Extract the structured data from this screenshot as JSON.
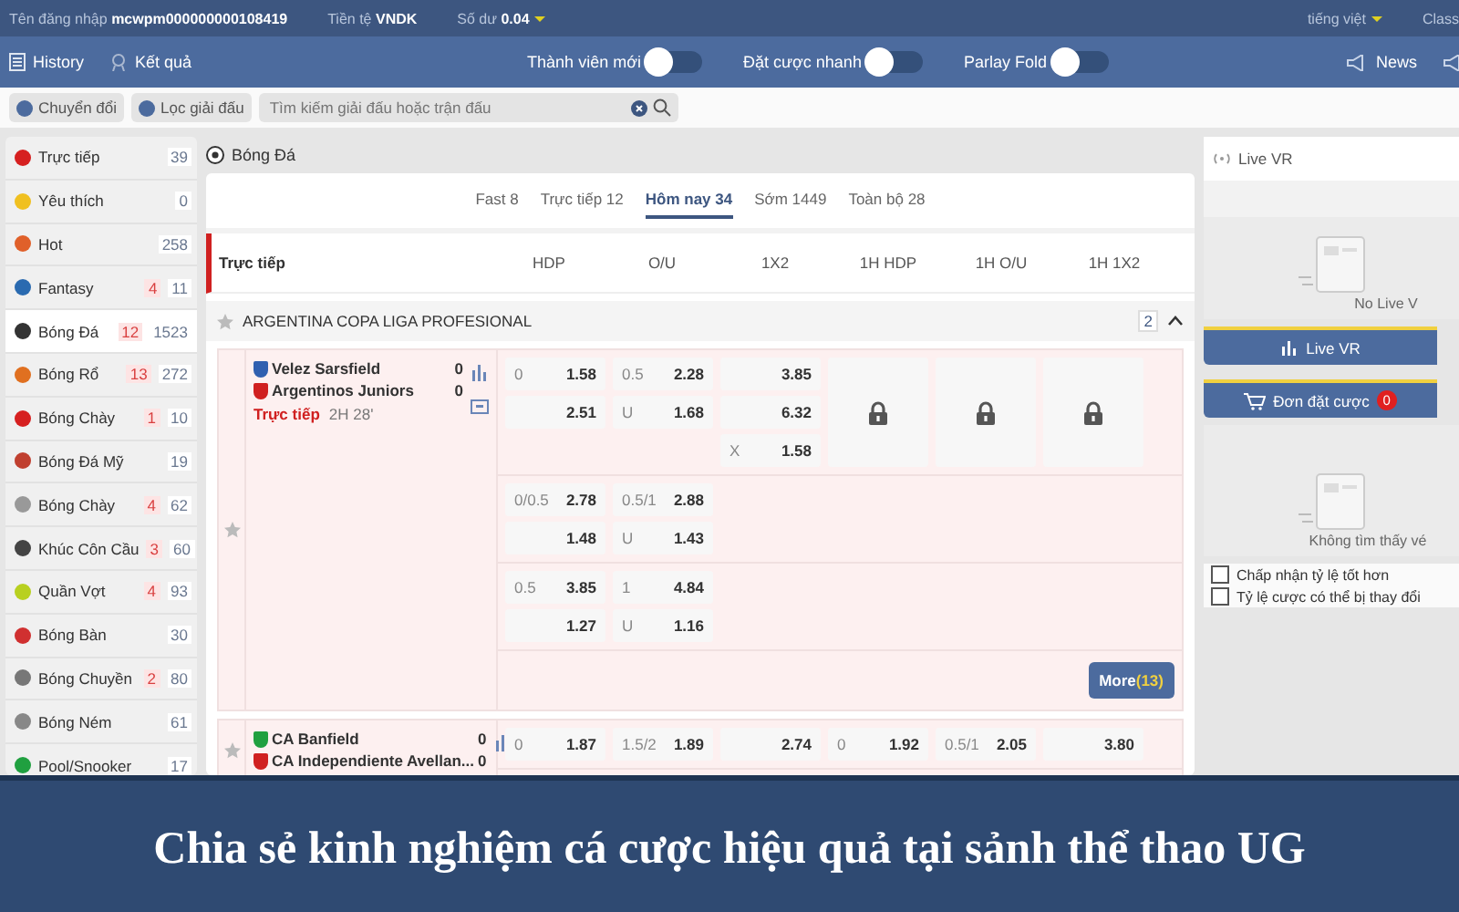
{
  "top_bar": {
    "fields": [
      {
        "label": "Tên đăng nhập",
        "value": "mcwpm000000000108419"
      },
      {
        "label": "Tiền tệ",
        "value": "VNDK"
      },
      {
        "label": "Số dư",
        "value": "0.04"
      }
    ],
    "language": "tiếng việt",
    "cut_item": "Class"
  },
  "nav_bar": {
    "links": [
      {
        "kind": "history",
        "label": "History"
      },
      {
        "kind": "results",
        "label": "Kết quả"
      }
    ],
    "toggles": [
      {
        "label": "Thành viên mới",
        "on": false
      },
      {
        "label": "Đặt cược nhanh",
        "on": false
      },
      {
        "label": "Parlay Fold",
        "on": false
      }
    ],
    "news": "News"
  },
  "filter_bar": {
    "buttons": [
      "Chuyển đổi",
      "Lọc giải đấu"
    ],
    "search": {
      "placeholder": "Tìm kiếm giải đấu hoặc trận đấu"
    }
  },
  "sidebar": {
    "items": [
      {
        "name": "Trực tiếp",
        "count": "39",
        "color": "#d62020",
        "selected": false
      },
      {
        "name": "Yêu thích",
        "count": "0",
        "color": "#f0c020",
        "selected": false
      },
      {
        "name": "Hot",
        "count": "258",
        "color": "#e0602a",
        "selected": false
      },
      {
        "name": "Fantasy",
        "live": "4",
        "count": "11",
        "color": "#2a6ab0",
        "selected": false
      },
      {
        "name": "Bóng Đá",
        "live": "12",
        "count": "1523",
        "color": "#333333",
        "selected": true
      },
      {
        "name": "Bóng Rổ",
        "live": "13",
        "count": "272",
        "color": "#e07020",
        "selected": false
      },
      {
        "name": "Bóng Chày",
        "live": "1",
        "count": "10",
        "color": "#d62020",
        "selected": false
      },
      {
        "name": "Bóng Đá Mỹ",
        "count": "19",
        "color": "#c04030",
        "selected": false
      },
      {
        "name": "Bóng Chày",
        "live": "4",
        "count": "62",
        "color": "#999999",
        "selected": false
      },
      {
        "name": "Khúc Côn Cầu",
        "live": "3",
        "count": "60",
        "color": "#444444",
        "selected": false
      },
      {
        "name": "Quần Vợt",
        "live": "4",
        "count": "93",
        "color": "#b8d020",
        "selected": false
      },
      {
        "name": "Bóng Bàn",
        "count": "30",
        "color": "#d03030",
        "selected": false
      },
      {
        "name": "Bóng Chuyền",
        "live": "2",
        "count": "80",
        "color": "#777777",
        "selected": false
      },
      {
        "name": "Bóng Ném",
        "count": "61",
        "color": "#888888",
        "selected": false
      },
      {
        "name": "Pool/Snooker",
        "count": "17",
        "color": "#20a040",
        "selected": false
      }
    ]
  },
  "main": {
    "title": "Bóng Đá",
    "tabs": [
      {
        "label": "Fast 8",
        "selected": false
      },
      {
        "label": "Trực tiếp 12",
        "selected": false
      },
      {
        "label": "Hôm nay 34",
        "selected": true
      },
      {
        "label": "Sớm 1449",
        "selected": false
      },
      {
        "label": "Toàn bộ 28",
        "selected": false
      }
    ],
    "section": "Trực tiếp",
    "columns": [
      "HDP",
      "O/U",
      "1X2",
      "1H HDP",
      "1H O/U",
      "1H 1X2"
    ],
    "league": {
      "name": "ARGENTINA COPA LIGA PROFESIONAL",
      "count": "2"
    },
    "matches": [
      {
        "teams": [
          {
            "name": "Velez Sarsfield",
            "score": "0",
            "color": "#3060b0"
          },
          {
            "name": "Argentinos Juniors",
            "score": "0",
            "color": "#d02020"
          }
        ],
        "status": "Trực tiếp",
        "time": "2H 28'",
        "groups": [
          {
            "columns": [
              {
                "kind": "odds",
                "cells": [
                  {
                    "line": "0",
                    "odds": "1.58"
                  },
                  {
                    "odds": "2.51"
                  }
                ]
              },
              {
                "kind": "odds",
                "cells": [
                  {
                    "line": "0.5",
                    "odds": "2.28"
                  },
                  {
                    "line": "U",
                    "odds": "1.68"
                  }
                ]
              },
              {
                "kind": "odds",
                "cells": [
                  {
                    "odds": "3.85"
                  },
                  {
                    "odds": "6.32"
                  },
                  {
                    "line": "X",
                    "odds": "1.58"
                  }
                ]
              },
              {
                "kind": "locked"
              },
              {
                "kind": "locked"
              },
              {
                "kind": "locked"
              }
            ]
          },
          {
            "columns": [
              {
                "kind": "odds",
                "cells": [
                  {
                    "line": "0/0.5",
                    "odds": "2.78"
                  },
                  {
                    "odds": "1.48"
                  }
                ]
              },
              {
                "kind": "odds",
                "cells": [
                  {
                    "line": "0.5/1",
                    "odds": "2.88"
                  },
                  {
                    "line": "U",
                    "odds": "1.43"
                  }
                ]
              }
            ]
          },
          {
            "columns": [
              {
                "kind": "odds",
                "cells": [
                  {
                    "line": "0.5",
                    "odds": "3.85"
                  },
                  {
                    "odds": "1.27"
                  }
                ]
              },
              {
                "kind": "odds",
                "cells": [
                  {
                    "line": "1",
                    "odds": "4.84"
                  },
                  {
                    "line": "U",
                    "odds": "1.16"
                  }
                ]
              }
            ]
          }
        ],
        "more": {
          "label": "More",
          "count": "(13)"
        }
      },
      {
        "teams": [
          {
            "name": "CA Banfield",
            "score": "0",
            "color": "#20a040"
          },
          {
            "name": "CA Independiente Avellan...",
            "score": "0",
            "color": "#d02020"
          }
        ],
        "groups": [
          {
            "columns": [
              {
                "kind": "odds",
                "cells": [
                  {
                    "line": "0",
                    "odds": "1.87"
                  }
                ]
              },
              {
                "kind": "odds",
                "cells": [
                  {
                    "line": "1.5/2",
                    "odds": "1.89"
                  }
                ]
              },
              {
                "kind": "odds",
                "cells": [
                  {
                    "odds": "2.74"
                  }
                ]
              },
              {
                "kind": "odds",
                "cells": [
                  {
                    "line": "0",
                    "odds": "1.92"
                  }
                ]
              },
              {
                "kind": "odds",
                "cells": [
                  {
                    "line": "0.5/1",
                    "odds": "2.05"
                  }
                ]
              },
              {
                "kind": "odds",
                "cells": [
                  {
                    "odds": "3.80"
                  }
                ]
              }
            ]
          }
        ]
      }
    ]
  },
  "right_panel": {
    "live_title": "Live VR",
    "live_empty": "No Live V",
    "live_button": "Live VR",
    "slip": {
      "label": "Đơn đặt cược",
      "count": "0"
    },
    "slip_empty": "Không tìm thấy vé",
    "options": [
      {
        "label": "Chấp nhận tỷ lệ tốt hơn",
        "checked": false
      },
      {
        "label": "Tỷ lệ cược có thể bị thay đổi",
        "checked": false
      }
    ]
  },
  "caption": "Chia sẻ kinh nghiệm cá cược hiệu quả tại sảnh thể thao UG"
}
